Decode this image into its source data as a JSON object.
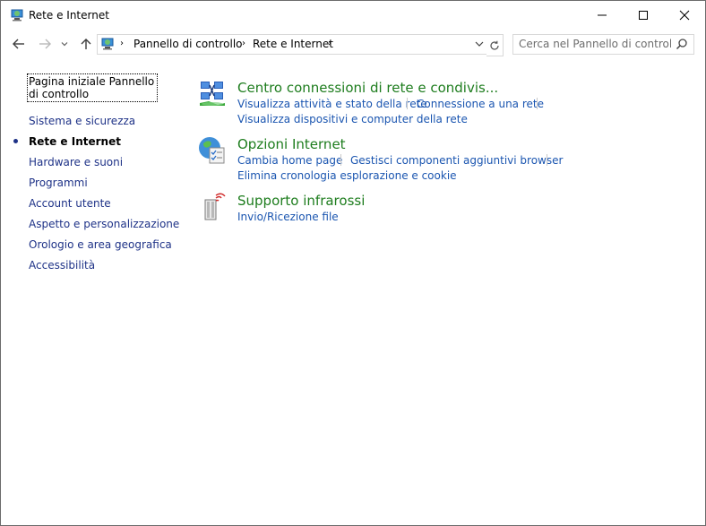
{
  "window": {
    "title": "Rete e Internet"
  },
  "address": {
    "crumbs": [
      "Pannello di controllo",
      "Rete e Internet"
    ]
  },
  "search": {
    "placeholder": "Cerca nel Pannello di controllo"
  },
  "sidebar": {
    "home": "Pagina iniziale Pannello di controllo",
    "items": [
      {
        "label": "Sistema e sicurezza"
      },
      {
        "label": "Rete e Internet",
        "active": true
      },
      {
        "label": "Hardware e suoni"
      },
      {
        "label": "Programmi"
      },
      {
        "label": "Account utente"
      },
      {
        "label": "Aspetto e personalizzazione"
      },
      {
        "label": "Orologio e area geografica"
      },
      {
        "label": "Accessibilità"
      }
    ]
  },
  "categories": [
    {
      "title": "Centro connessioni di rete e condivis...",
      "icon": "network-center-icon",
      "tasks": [
        "Visualizza attività e stato della rete",
        "Connessione a una rete",
        "Visualizza dispositivi e computer della rete"
      ]
    },
    {
      "title": "Opzioni Internet",
      "icon": "internet-options-icon",
      "tasks": [
        "Cambia home page",
        "Gestisci componenti aggiuntivi browser",
        "Elimina cronologia esplorazione e cookie"
      ]
    },
    {
      "title": "Supporto infrarossi",
      "icon": "infrared-icon",
      "tasks": [
        "Invio/Ricezione file"
      ]
    }
  ],
  "colors": {
    "category_title": "#1e7d1e",
    "task_link": "#1a55b0",
    "sidebar_link": "#1e3287"
  }
}
